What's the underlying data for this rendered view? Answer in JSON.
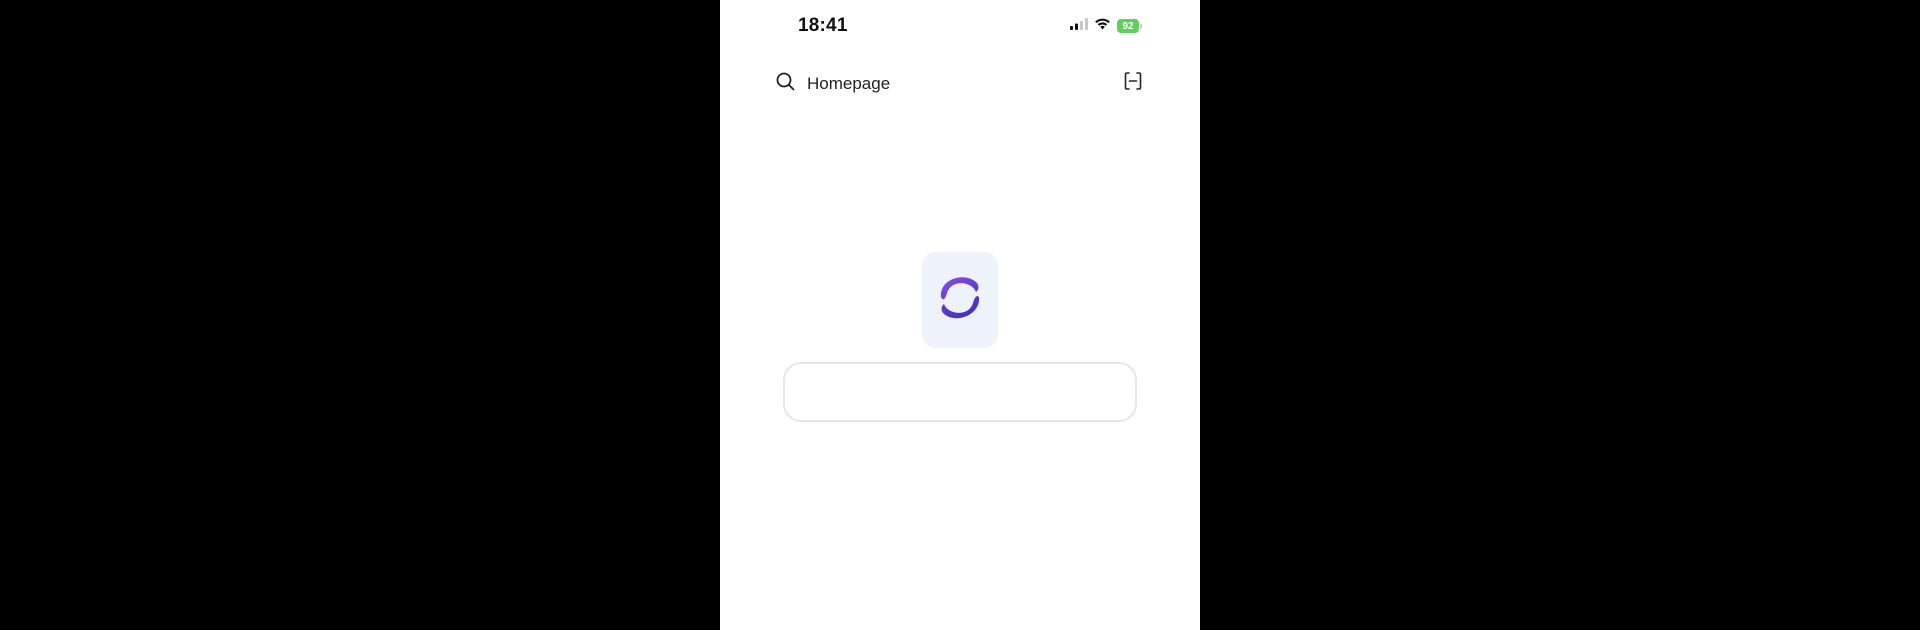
{
  "status_bar": {
    "time": "18:41",
    "battery_level": "92",
    "signal_icon": "cellular-signal-icon",
    "wifi_icon": "wifi-icon",
    "battery_icon": "battery-icon",
    "battery_color": "#5bd15b"
  },
  "header": {
    "search_label": "Homepage",
    "search_icon": "search-icon",
    "scan_icon": "scan-icon"
  },
  "main": {
    "logo_icon": "app-logo-icon",
    "logo_colors": [
      "#5b3bd6",
      "#8a4fe0"
    ],
    "input_value": "",
    "input_placeholder": ""
  }
}
